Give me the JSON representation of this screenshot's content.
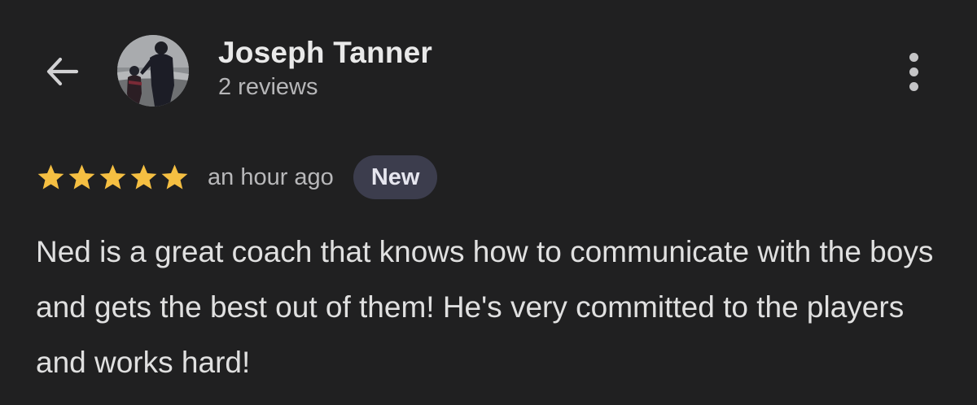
{
  "header": {
    "back_icon": "arrow-left-icon",
    "reviewer_name": "Joseph Tanner",
    "review_count": "2 reviews",
    "more_icon": "more-vertical-icon"
  },
  "review": {
    "rating": 5,
    "rating_max": 5,
    "star_icon": "star-icon",
    "star_color": "#f5bf42",
    "time": "an hour ago",
    "badge": "New",
    "text": "Ned is a great coach that knows how to communicate with the boys and gets the best out of them! He's very committed to the players and works hard!"
  },
  "colors": {
    "background": "#202021",
    "badge_background": "#3c3d4d"
  }
}
